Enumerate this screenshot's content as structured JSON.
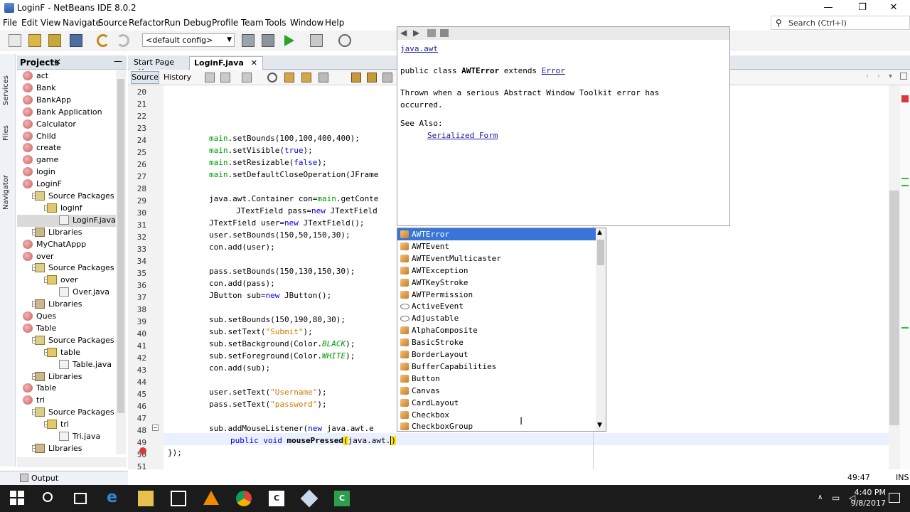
{
  "window": {
    "title": "LoginF - NetBeans IDE 8.0.2",
    "minimize": "—",
    "maximize": "❐",
    "close": "✕"
  },
  "menu": [
    "File",
    "Edit",
    "View",
    "Navigate",
    "Source",
    "Refactor",
    "Run",
    "Debug",
    "Profile",
    "Team",
    "Tools",
    "Window",
    "Help"
  ],
  "search": {
    "placeholder": "Search (Ctrl+I)"
  },
  "toolbar": {
    "config": "<default config>"
  },
  "side_tabs": [
    "Services",
    "Files",
    "Navigator"
  ],
  "projects_panel": {
    "title": "Projects",
    "close": "✕",
    "minimize": "—",
    "tree": [
      {
        "label": "act",
        "type": "project"
      },
      {
        "label": "Bank",
        "type": "project"
      },
      {
        "label": "BankApp",
        "type": "project"
      },
      {
        "label": "Bank Application",
        "type": "project"
      },
      {
        "label": "Calculator",
        "type": "project"
      },
      {
        "label": "Child",
        "type": "project"
      },
      {
        "label": "create",
        "type": "project"
      },
      {
        "label": "game",
        "type": "project"
      },
      {
        "label": "login",
        "type": "project"
      },
      {
        "label": "LoginF",
        "type": "project"
      },
      {
        "label": "Source Packages",
        "type": "packages"
      },
      {
        "label": "loginf",
        "type": "package"
      },
      {
        "label": "LoginF.java",
        "type": "java"
      },
      {
        "label": "Libraries",
        "type": "libraries"
      },
      {
        "label": "MyChatAppp",
        "type": "project"
      },
      {
        "label": "over",
        "type": "project"
      },
      {
        "label": "Source Packages",
        "type": "packages"
      },
      {
        "label": "over",
        "type": "package"
      },
      {
        "label": "Over.java",
        "type": "java"
      },
      {
        "label": "Libraries",
        "type": "libraries"
      },
      {
        "label": "Ques",
        "type": "project"
      },
      {
        "label": "Table",
        "type": "project"
      },
      {
        "label": "Source Packages",
        "type": "packages"
      },
      {
        "label": "table",
        "type": "package"
      },
      {
        "label": "Table.java",
        "type": "java"
      },
      {
        "label": "Libraries",
        "type": "libraries"
      },
      {
        "label": "Table",
        "type": "project"
      },
      {
        "label": "tri",
        "type": "project"
      },
      {
        "label": "Source Packages",
        "type": "packages"
      },
      {
        "label": "tri",
        "type": "package"
      },
      {
        "label": "Tri.java",
        "type": "java"
      },
      {
        "label": "Libraries",
        "type": "libraries"
      }
    ]
  },
  "output_bar": {
    "label": "Output"
  },
  "editor": {
    "tabs": [
      {
        "label": "Start Page",
        "close": "✕"
      },
      {
        "label": "LoginF.java",
        "close": "✕"
      }
    ],
    "source_btn": "Source",
    "history_btn": "History",
    "line_numbers": [
      "20",
      "21",
      "22",
      "23",
      "24",
      "25",
      "26",
      "27",
      "28",
      "29",
      "30",
      "31",
      "32",
      "33",
      "34",
      "35",
      "36",
      "37",
      "38",
      "39",
      "40",
      "41",
      "42",
      "43",
      "44",
      "45",
      "46",
      "47",
      "48",
      "49",
      "50",
      "51"
    ]
  },
  "javadoc": {
    "package": "java.awt",
    "signature_prefix": "public class ",
    "class_name": "AWTError",
    "signature_mid": " extends ",
    "extends": "Error",
    "description_line1": "Thrown when a serious Abstract Window Toolkit error has",
    "description_line2": "occurred.",
    "see_also": "See Also:",
    "see_also_link": "Serialized Form"
  },
  "completion": {
    "items": [
      {
        "label": "AWTError",
        "selected": true,
        "kind": "class"
      },
      {
        "label": "AWTEvent",
        "kind": "class"
      },
      {
        "label": "AWTEventMulticaster",
        "kind": "class"
      },
      {
        "label": "AWTException",
        "kind": "class"
      },
      {
        "label": "AWTKeyStroke",
        "kind": "class"
      },
      {
        "label": "AWTPermission",
        "kind": "class"
      },
      {
        "label": "ActiveEvent",
        "kind": "interface"
      },
      {
        "label": "Adjustable",
        "kind": "interface"
      },
      {
        "label": "AlphaComposite",
        "kind": "class"
      },
      {
        "label": "BasicStroke",
        "kind": "class"
      },
      {
        "label": "BorderLayout",
        "kind": "class"
      },
      {
        "label": "BufferCapabilities",
        "kind": "class"
      },
      {
        "label": "Button",
        "kind": "class"
      },
      {
        "label": "Canvas",
        "kind": "class"
      },
      {
        "label": "CardLayout",
        "kind": "class"
      },
      {
        "label": "Checkbox",
        "kind": "class"
      },
      {
        "label": "CheckboxGroup",
        "kind": "class"
      }
    ]
  },
  "status": {
    "position": "49:47",
    "mode": "INS"
  },
  "taskbar": {
    "time": "4:40 PM",
    "date": "9/8/2017"
  },
  "colors": {
    "selection": "#3875d7",
    "field": "#009900",
    "keyword": "#0000e6",
    "string": "#ce7b00"
  }
}
